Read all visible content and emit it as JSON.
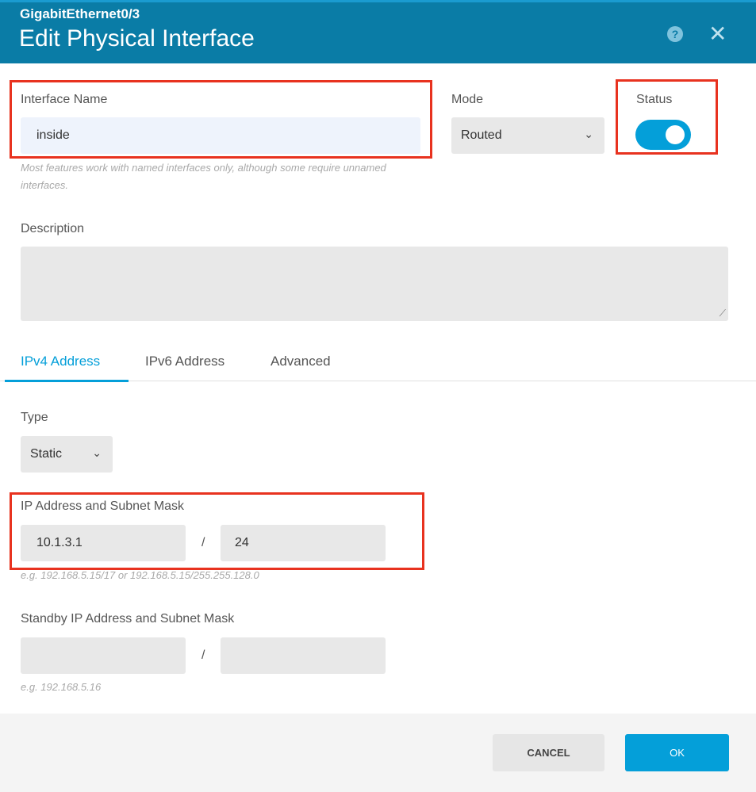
{
  "header": {
    "subtitle": "GigabitEthernet0/3",
    "title": "Edit Physical Interface",
    "help_icon": "?",
    "close_icon": "✕"
  },
  "interface_name": {
    "label": "Interface Name",
    "value": "inside",
    "hint": "Most features work with named interfaces only, although some require unnamed interfaces."
  },
  "mode": {
    "label": "Mode",
    "value": "Routed"
  },
  "status": {
    "label": "Status",
    "enabled": true
  },
  "description": {
    "label": "Description",
    "value": ""
  },
  "tabs": [
    {
      "label": "IPv4 Address",
      "active": true
    },
    {
      "label": "IPv6 Address"
    },
    {
      "label": "Advanced"
    }
  ],
  "type": {
    "label": "Type",
    "value": "Static"
  },
  "ip": {
    "label": "IP Address and Subnet Mask",
    "address": "10.1.3.1",
    "separator": "/",
    "mask": "24",
    "hint": "e.g. 192.168.5.15/17 or 192.168.5.15/255.255.128.0"
  },
  "standby": {
    "label": "Standby IP Address and Subnet Mask",
    "address": "",
    "separator": "/",
    "mask": "",
    "hint": "e.g. 192.168.5.16"
  },
  "footer": {
    "cancel": "CANCEL",
    "ok": "OK"
  },
  "colors": {
    "header": "#0a7ca6",
    "accent": "#049fd9",
    "highlight": "#e8321f"
  }
}
